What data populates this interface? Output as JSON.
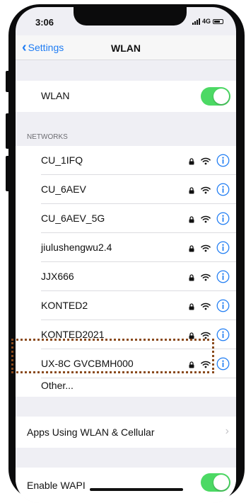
{
  "status_bar": {
    "time": "3:06",
    "network": "4G"
  },
  "nav": {
    "back_label": "Settings",
    "title": "WLAN"
  },
  "wlan_toggle": {
    "label": "WLAN",
    "on": true
  },
  "networks": {
    "header": "NETWORKS",
    "items": [
      {
        "name": "CU_1IFQ"
      },
      {
        "name": "CU_6AEV"
      },
      {
        "name": "CU_6AEV_5G"
      },
      {
        "name": "jiulushengwu2.4"
      },
      {
        "name": "JJX666"
      },
      {
        "name": "KONTED2"
      },
      {
        "name": "KONTED2021"
      },
      {
        "name": "UX-8C GVCBMH000"
      }
    ],
    "other_label": "Other..."
  },
  "apps_row": {
    "label": "Apps Using WLAN & Cellular"
  },
  "wapi": {
    "label": "Enable WAPI",
    "on": true
  },
  "colors": {
    "accent": "#1e7cf3",
    "toggle_on": "#4cd964",
    "highlight_border": "#8a4a1c"
  },
  "icons": {
    "lock": "lock-icon",
    "wifi": "wifi-icon",
    "info": "info-icon",
    "back": "chevron-left-icon",
    "disclosure": "chevron-right-icon"
  }
}
